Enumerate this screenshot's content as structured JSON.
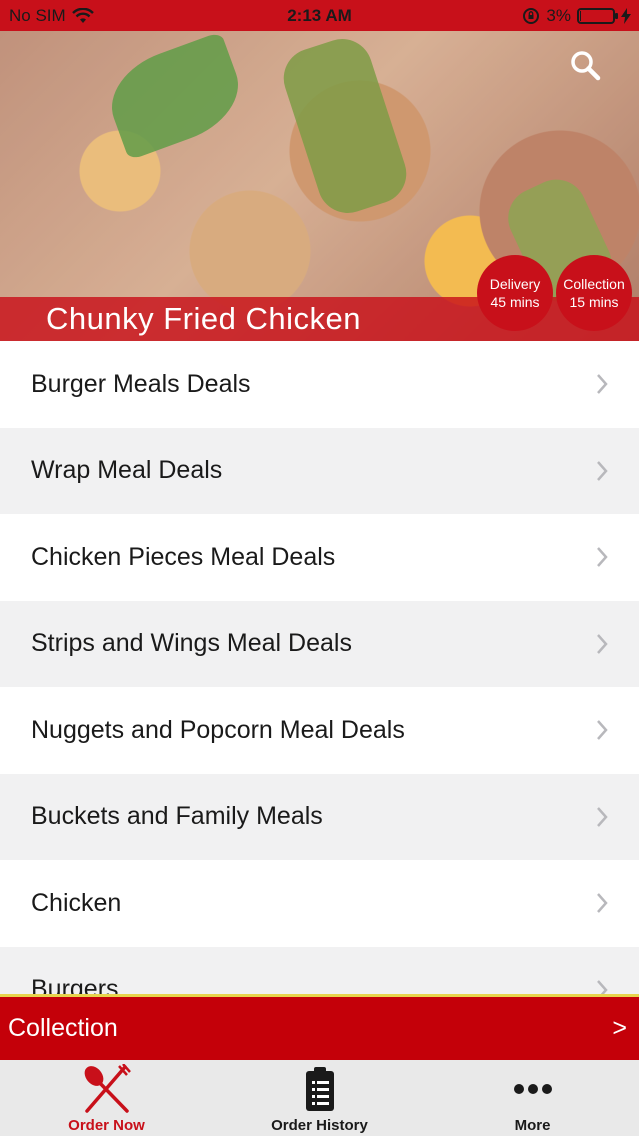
{
  "status_bar": {
    "carrier": "No SIM",
    "time": "2:13 AM",
    "battery_percent": "3%",
    "battery_level": 0.03
  },
  "hero": {
    "restaurant_name": "Chunky Fried Chicken",
    "delivery": {
      "label": "Delivery",
      "time": "45 mins"
    },
    "collection": {
      "label": "Collection",
      "time": "15 mins"
    },
    "search_icon": "search-icon"
  },
  "menu": {
    "items": [
      {
        "label": "Burger Meals Deals"
      },
      {
        "label": "Wrap Meal Deals"
      },
      {
        "label": "Chicken Pieces Meal Deals"
      },
      {
        "label": "Strips and Wings Meal Deals"
      },
      {
        "label": "Nuggets and Popcorn Meal Deals"
      },
      {
        "label": "Buckets and Family Meals"
      },
      {
        "label": "Chicken"
      },
      {
        "label": "Burgers"
      }
    ]
  },
  "order_mode_bar": {
    "label": "Collection",
    "arrow": ">"
  },
  "tab_bar": {
    "tabs": [
      {
        "label": "Order Now",
        "icon": "fork-knife-icon",
        "active": true
      },
      {
        "label": "Order History",
        "icon": "clipboard-icon",
        "active": false
      },
      {
        "label": "More",
        "icon": "more-dots-icon",
        "active": false
      }
    ]
  },
  "colors": {
    "brand_red": "#c8101a",
    "collection_bar": "#c40009",
    "accent_yellow": "#e8d44d",
    "tab_bar_bg": "#e9e9e9"
  }
}
